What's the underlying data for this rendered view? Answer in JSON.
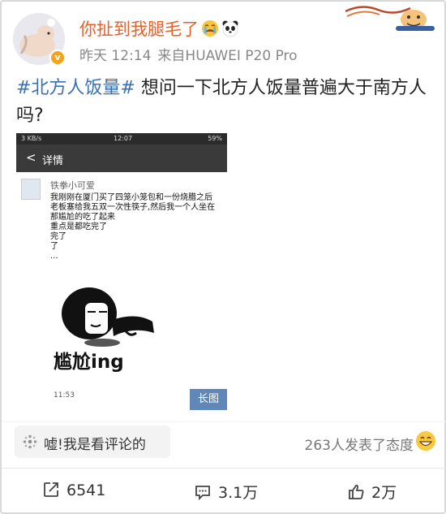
{
  "author": {
    "name": "你扯到我腿毛了",
    "verified_badge": "v"
  },
  "meta": {
    "time": "昨天 12:14",
    "source": "来自HUAWEI P20 Pro"
  },
  "post": {
    "hashtag": "#北方人饭量#",
    "text": " 想问一下北方人饭量普遍大于南方人吗?"
  },
  "embedded_screenshot": {
    "status_left": "3 KB/s",
    "status_time": "12:07",
    "status_right": "59%",
    "nav_back": "<",
    "nav_title": "详情",
    "quote_author": "铁拳小可爱",
    "quote_lines": [
      "我刚刚在厦门买了四笼小笼包和一份烧腊之后",
      "老板塞给我五双一次性筷子,然后我一个人坐在",
      "那尴尬的吃了起来",
      "重点是都吃完了",
      "完了",
      "了",
      "..."
    ],
    "meme_caption": "尴尬ing",
    "time": "11:53",
    "long_image_label": "长图"
  },
  "comment_prompt": {
    "icon": "sparkle-icon",
    "text": "嘘!我是看评论的"
  },
  "attitude_text": "263人发表了态度",
  "actions": {
    "repost": "6541",
    "comment": "3.1万",
    "like": "2万"
  },
  "colors": {
    "username": "#e8602a",
    "hashtag": "#3b6fb6",
    "long_image_bg": "#5f87b8",
    "badge": "#f6a21a"
  }
}
